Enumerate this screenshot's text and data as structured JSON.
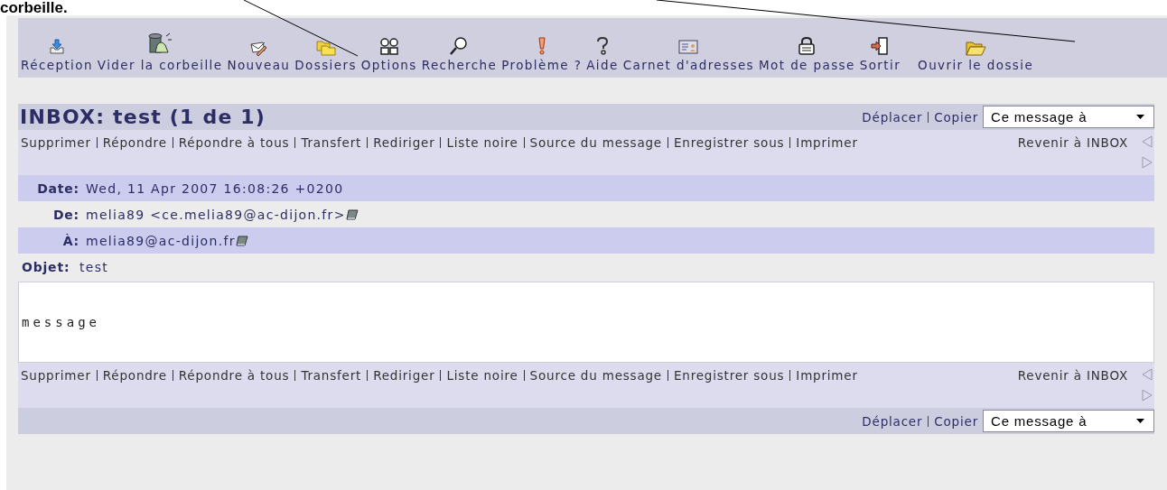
{
  "annotation": {
    "text": "corbeille."
  },
  "toolbar": [
    {
      "label": "Réception",
      "kind": "inbox"
    },
    {
      "label": "Vider la corbeille",
      "kind": "trash"
    },
    {
      "label": "Nouveau",
      "kind": "compose"
    },
    {
      "label": "Dossiers",
      "kind": "folders"
    },
    {
      "label": "Options",
      "kind": "options"
    },
    {
      "label": "Recherche",
      "kind": "search"
    },
    {
      "label": "Problème ?",
      "kind": "problem"
    },
    {
      "label": "Aide",
      "kind": "help"
    },
    {
      "label": "Carnet d'adresses",
      "kind": "addressbook"
    },
    {
      "label": "Mot de passe",
      "kind": "lock"
    },
    {
      "label": "Sortir",
      "kind": "exit"
    },
    {
      "label": "Ouvrir le dossie",
      "kind": "openfolder"
    }
  ],
  "title": "INBOX: test (1 de 1)",
  "move_links": [
    "Déplacer",
    "Copier"
  ],
  "move_select": "Ce message à",
  "actions": [
    "Supprimer",
    "Répondre",
    "Répondre à tous",
    "Transfert",
    "Rediriger",
    "Liste noire",
    "Source du message",
    "Enregistrer sous",
    "Imprimer"
  ],
  "back_link": "Revenir à INBOX",
  "headers": [
    {
      "label": "Date:",
      "value": "Wed, 11 Apr 2007 16:08:26 +0200",
      "book": false
    },
    {
      "label": "De:",
      "value": "melia89 <ce.melia89@ac-dijon.fr>",
      "book": true
    },
    {
      "label": "À:",
      "value": "melia89@ac-dijon.fr",
      "book": true
    },
    {
      "label": "Objet:",
      "value": "test",
      "book": false
    }
  ],
  "body": "message",
  "bottom_actions": [
    "Supprimer",
    "Répondre",
    "Répondre à tous",
    "Transfert",
    "Rediriger",
    "Liste noire",
    "Source du message",
    "Enregistrer sous",
    "Imprimer"
  ],
  "bottom_back_link": "Revenir à INBOX",
  "bottom_move_links": [
    "Déplacer",
    "Copier"
  ],
  "bottom_move_select": "Ce message à"
}
